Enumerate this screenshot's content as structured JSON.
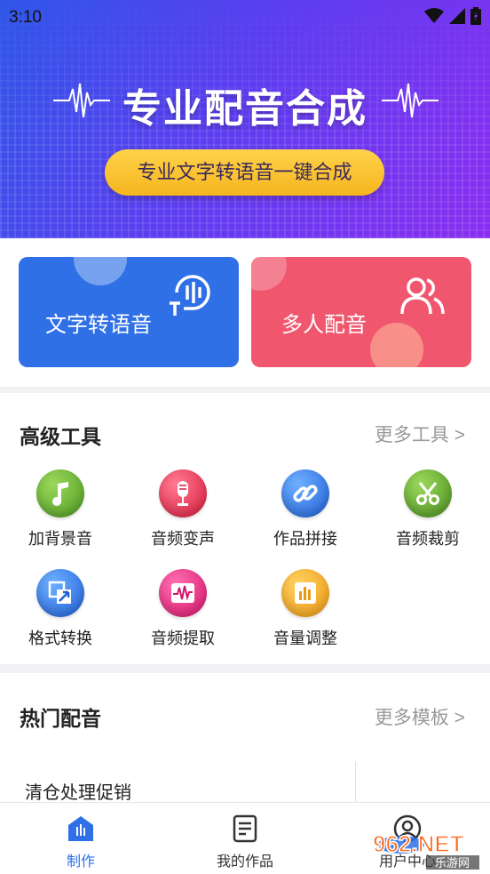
{
  "status": {
    "time": "3:10"
  },
  "banner": {
    "title": "专业配音合成",
    "pill": "专业文字转语音一键合成"
  },
  "cards": [
    {
      "label": "文字转语音",
      "icon": "speech-to-text-icon"
    },
    {
      "label": "多人配音",
      "icon": "users-icon"
    }
  ],
  "tools": {
    "title": "高级工具",
    "more": "更多工具 >",
    "items": [
      {
        "label": "加背景音",
        "icon": "music-note-icon",
        "color": "#5aa52a"
      },
      {
        "label": "音频变声",
        "icon": "microphone-icon",
        "color": "#e8284a"
      },
      {
        "label": "作品拼接",
        "icon": "link-icon",
        "color": "#2f74e0"
      },
      {
        "label": "音频裁剪",
        "icon": "scissors-icon",
        "color": "#4e9a2a"
      },
      {
        "label": "格式转换",
        "icon": "convert-icon",
        "color": "#2f74e0"
      },
      {
        "label": "音频提取",
        "icon": "waveform-icon",
        "color": "#e6247a"
      },
      {
        "label": "音量调整",
        "icon": "volume-bars-icon",
        "color": "#f2a21a"
      }
    ]
  },
  "hot": {
    "title": "热门配音",
    "more": "更多模板 >",
    "item": "清仓处理促销"
  },
  "nav": [
    {
      "label": "制作",
      "icon": "make-icon",
      "active": true
    },
    {
      "label": "我的作品",
      "icon": "document-icon",
      "active": false
    },
    {
      "label": "用户中心",
      "icon": "user-icon",
      "active": false
    }
  ],
  "watermark": {
    "text": "962.NET",
    "subtext": "乐游网"
  },
  "colors": {
    "primary": "#2f70e6",
    "accent_pink": "#f0576e",
    "pill_yellow": "#f5b51e"
  }
}
